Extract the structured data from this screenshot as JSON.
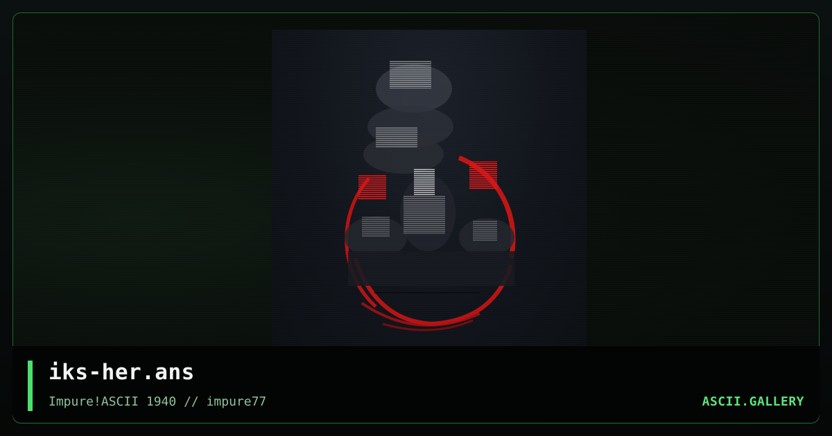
{
  "artwork": {
    "file_name": "iks-her.ans",
    "meta": "Impure!ASCII 1940 // impure77",
    "alt": "iks-her.ans"
  },
  "brand": {
    "label": "ASCII.GALLERY"
  },
  "colors": {
    "accent": "#4cdf6e",
    "frame_border": "#1f6b2e",
    "art_red": "#d41414"
  }
}
